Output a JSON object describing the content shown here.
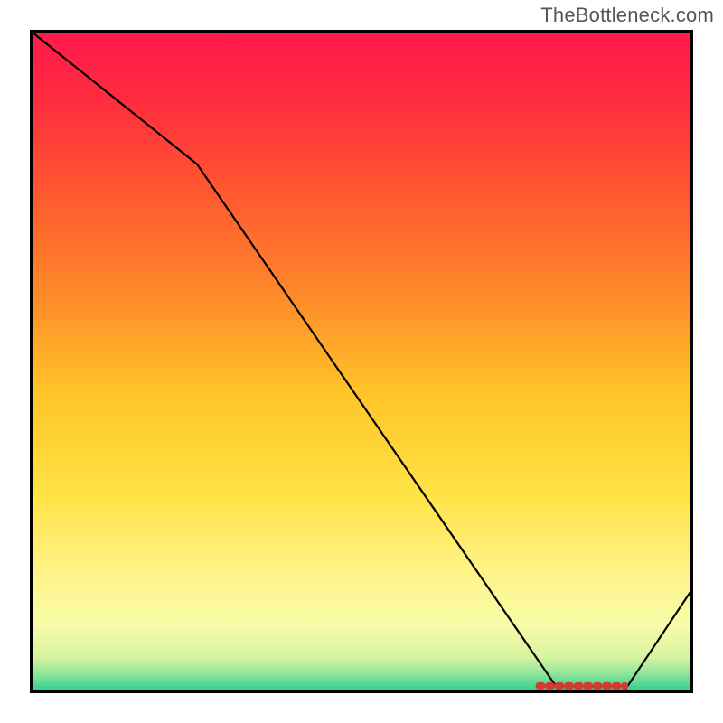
{
  "watermark": "TheBottleneck.com",
  "chart_data": {
    "type": "line",
    "title": "",
    "xlabel": "",
    "ylabel": "",
    "xlim": [
      0,
      100
    ],
    "ylim": [
      0,
      100
    ],
    "x": [
      0,
      25,
      80,
      90,
      100
    ],
    "values": [
      100,
      80,
      0,
      0,
      15
    ],
    "low_band": {
      "x_start": 77,
      "x_end": 90,
      "y": 0
    },
    "background_gradient": {
      "stops": [
        {
          "offset": 0.0,
          "color": "#ff1a4b"
        },
        {
          "offset": 0.1,
          "color": "#ff2b3f"
        },
        {
          "offset": 0.25,
          "color": "#ff5a2f"
        },
        {
          "offset": 0.4,
          "color": "#ff8a2a"
        },
        {
          "offset": 0.55,
          "color": "#ffc528"
        },
        {
          "offset": 0.7,
          "color": "#ffe244"
        },
        {
          "offset": 0.82,
          "color": "#fff388"
        },
        {
          "offset": 0.9,
          "color": "#f8fca8"
        },
        {
          "offset": 0.95,
          "color": "#d6f3a0"
        },
        {
          "offset": 0.975,
          "color": "#8de59a"
        },
        {
          "offset": 1.0,
          "color": "#2fcf8f"
        }
      ]
    }
  }
}
